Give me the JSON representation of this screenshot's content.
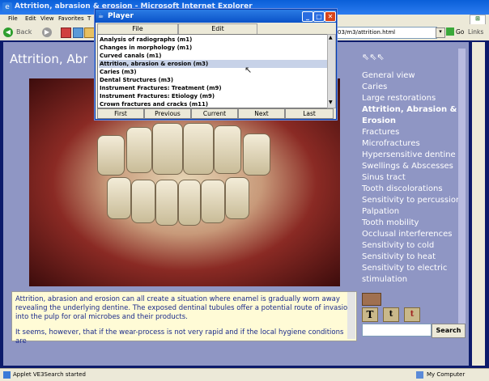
{
  "ie": {
    "title": "Attrition, abrasion & erosion - Microsoft Internet Explorer",
    "menu": [
      "File",
      "Edit",
      "View",
      "Favorites",
      "T"
    ],
    "back_label": "Back",
    "address": "03/m3/attrition.html",
    "go_label": "Go",
    "links_label": "Links",
    "status_left": "Applet VE3Search started",
    "status_right": "My Computer"
  },
  "page": {
    "title": "Attrition, Abr",
    "description_lines": [
      "Attrition, abrasion and erosion can all create a situation where enamel is gradually worn away revealing the underlying dentine. The exposed dentinal tubules offer a potential route of invasion into the pulp for oral microbes and their products.",
      "It seems, however, that if the wear-process is not very rapid and if the local hygiene conditions are"
    ],
    "nav_items": [
      "General view",
      "Caries",
      "Large restorations",
      "Attrition, Abrasion &",
      "Erosion",
      "Fractures",
      "Microfractures",
      "Hypersensitive dentine",
      "Swellings & Abscesses",
      "Sinus tract",
      "Tooth discolorations",
      "Sensitivity to percussion",
      "Palpation",
      "Tooth mobility",
      "Occlusal interferences",
      "Sensitivity to cold",
      "Sensitivity to heat",
      "Sensitivity to electric",
      "stimulation"
    ],
    "font_buttons": [
      "T",
      "t",
      "t"
    ],
    "search_label": "Search"
  },
  "player": {
    "title": "Player",
    "menu": [
      "File",
      "Edit"
    ],
    "list": [
      "Analysis of radiographs (m1)",
      "Changes in morphology (m1)",
      "Curved canals (m1)",
      "Attrition, abrasion & erosion (m3)",
      "Caries (m3)",
      "Dental Structures (m3)",
      "Instrument Fractures: Treatment (m9)",
      "Instrument Fractures: Etiology (m9)",
      "Crown fractures and cracks (m11)"
    ],
    "selected_index": 3,
    "buttons": [
      "First",
      "Previous",
      "Current",
      "Next",
      "Last"
    ]
  }
}
